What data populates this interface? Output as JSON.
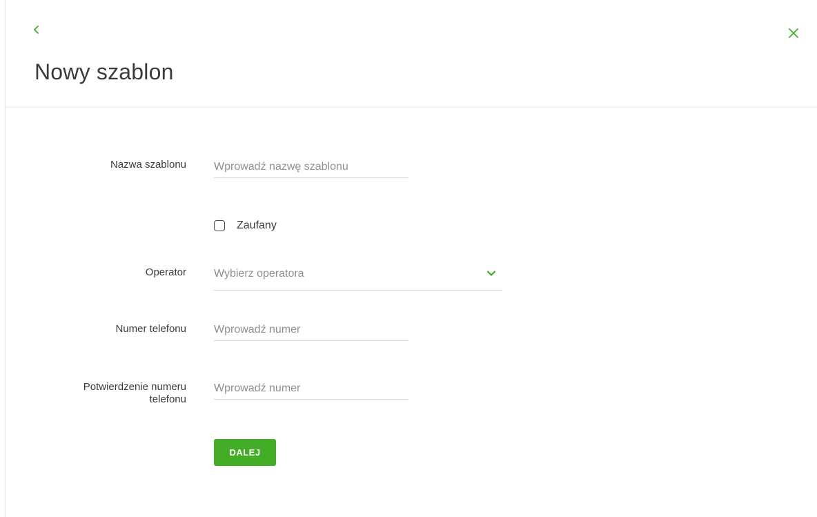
{
  "header": {
    "title": "Nowy szablon",
    "back_icon": "chevron-left-icon",
    "close_icon": "close-icon"
  },
  "form": {
    "template_name": {
      "label": "Nazwa szablonu",
      "placeholder": "Wprowadź nazwę szablonu",
      "value": ""
    },
    "trusted": {
      "label": "Zaufany",
      "checked": false
    },
    "operator": {
      "label": "Operator",
      "placeholder": "Wybierz operatora",
      "icon": "chevron-down-icon"
    },
    "phone_number": {
      "label": "Numer telefonu",
      "placeholder": "Wprowadź numer",
      "value": ""
    },
    "phone_confirm": {
      "label_line1": "Potwierdzenie numeru",
      "label_line2": "telefonu",
      "placeholder": "Wprowadź numer",
      "value": ""
    },
    "next_button": {
      "label": "DALEJ"
    }
  },
  "colors": {
    "accent": "#44ad27",
    "text": "#3a3a3a",
    "placeholder": "#8f8f8f",
    "divider": "#e8e8e8"
  }
}
